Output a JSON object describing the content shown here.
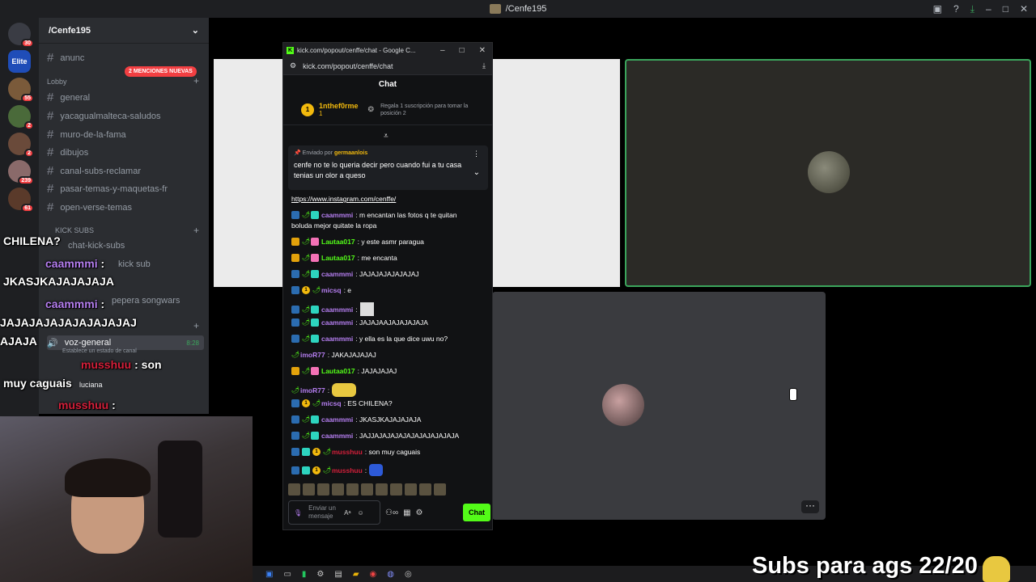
{
  "topbar": {
    "title": "/Cenfe195"
  },
  "servers": [
    {
      "label": "",
      "badge": "30"
    },
    {
      "label": "Elite",
      "badge": ""
    },
    {
      "label": "",
      "badge": "55"
    },
    {
      "label": "",
      "badge": "2"
    },
    {
      "label": "",
      "badge": "2"
    },
    {
      "label": "",
      "badge": "239"
    },
    {
      "label": "",
      "badge": "61"
    }
  ],
  "guild": {
    "name": "/Cenfe195",
    "mentions": "2 MENCIONES NUEVAS"
  },
  "channels": [
    {
      "name": "anunc"
    },
    {
      "name": "general"
    },
    {
      "name": "yacagualmalteca-saludos"
    },
    {
      "name": "muro-de-la-fama"
    },
    {
      "name": "dibujos"
    },
    {
      "name": "canal-subs-reclamar"
    },
    {
      "name": "pasar-temas-y-maquetas-fr"
    },
    {
      "name": "open-verse-temas"
    },
    {
      "name": "chat-kick-subs"
    },
    {
      "name": "kick sub"
    },
    {
      "name": "pepera songwars"
    }
  ],
  "categories": {
    "lobby": "Lobby",
    "kick_subs": "KICK SUBS"
  },
  "voice": {
    "channel": "voz-general",
    "time": "8:28",
    "status": "Establece un estado de canal",
    "user1": "luciana"
  },
  "overlay": [
    {
      "name": "",
      "text": "CHILENA?"
    },
    {
      "name": "caammmi",
      "text": ":"
    },
    {
      "name": "",
      "text": "JKASJKAJAJAJAJA"
    },
    {
      "name": "caammmi",
      "text": ":"
    },
    {
      "name": "",
      "text": "JAJAJAJAJAJAJAJAJAJ"
    },
    {
      "name": "",
      "text": "AJAJA"
    },
    {
      "name": "musshuu",
      "text": ": son"
    },
    {
      "name": "",
      "text": "muy caguais"
    },
    {
      "name": "musshuu",
      "text": ":"
    }
  ],
  "popout": {
    "window_title": "kick.com/popout/cenffe/chat - Google C...",
    "url": "kick.com/popout/cenffe/chat",
    "header": "Chat",
    "top_gifter": "1nthef0rme",
    "top_gifter_count": "1",
    "gift_prompt": "Regala 1 suscripción para tomar la posición 2",
    "pinned_by_label": "Enviado por",
    "pinned_by": "germaanlois",
    "pinned_msg": "cenfe no te lo queria decir pero cuando fui a tu casa tenias un olor a queso",
    "link": "https://www.instagram.com/cenffe/",
    "input_placeholder": "Enviar un mensaje",
    "send_label": "Chat"
  },
  "messages": [
    {
      "user": "caammmi",
      "text": ": m encantan las fotos q te quitan",
      "text2": "boluda mejor quitate la ropa",
      "color": "pur"
    },
    {
      "user": "Lautaa017",
      "text": ": y este asmr paragua",
      "color": "grn"
    },
    {
      "user": "Lautaa017",
      "text": ": me encanta",
      "color": "grn"
    },
    {
      "user": "caammmi",
      "text": ": JAJAJAJAJAJAJAJ",
      "color": "pur"
    },
    {
      "user": "micsq",
      "text": ": e",
      "color": "pur"
    },
    {
      "user": "caammmi",
      "text": ":",
      "color": "pur"
    },
    {
      "user": "caammmi",
      "text": ": JAJAJAAJAJAJAJAJA",
      "color": "pur"
    },
    {
      "user": "caammmi",
      "text": ": y ella es la que dice uwu no?",
      "color": "pur"
    },
    {
      "user": "imoR77",
      "text": ": JAKAJAJAJAJ",
      "color": "pur"
    },
    {
      "user": "Lautaa017",
      "text": ": JAJAJAJAJ",
      "color": "grn"
    },
    {
      "user": "imoR77",
      "text": ":",
      "color": "pur"
    },
    {
      "user": "micsq",
      "text": ": ES CHILENA?",
      "color": "pur"
    },
    {
      "user": "caammmi",
      "text": ": JKASJKAJAJAJAJA",
      "color": "pur"
    },
    {
      "user": "caammmi",
      "text": ": JAJJAJAJAJAJAJAJAJAJAJAJA",
      "color": "pur"
    },
    {
      "user": "musshuu",
      "text": ": son muy caguais",
      "color": "red"
    },
    {
      "user": "musshuu",
      "text": ":",
      "color": "red"
    }
  ],
  "subs_goal": "Subs para ags 22/20"
}
